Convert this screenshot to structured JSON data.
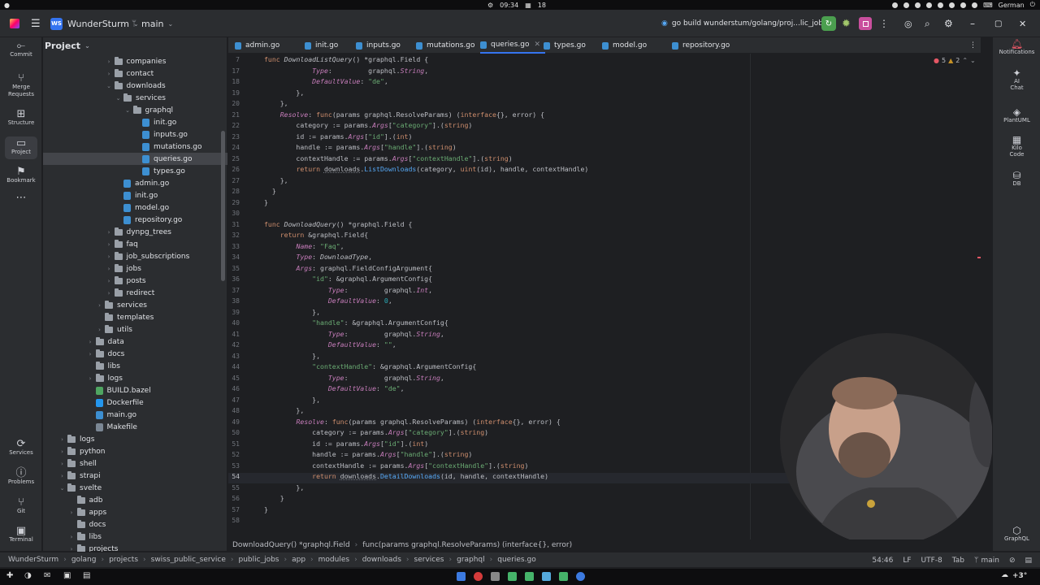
{
  "system_bar": {
    "time": "09:34",
    "calendar_day": "18",
    "lang": "German",
    "weather": "+3°"
  },
  "titlebar": {
    "project_badge": "WS",
    "project_name": "WunderSturm",
    "branch": "main",
    "run_config": "go build wunderstum/golang/proj...lic_jobs"
  },
  "left_strip": {
    "items": [
      {
        "label": "Commit",
        "icon": "commit-icon"
      },
      {
        "label": "Merge Requests",
        "icon": "merge-requests-icon"
      },
      {
        "label": "Structure",
        "icon": "structure-icon"
      },
      {
        "label": "Project",
        "icon": "folder-icon"
      },
      {
        "label": "Bookmark",
        "icon": "bookmark-icon"
      },
      {
        "label": "Services",
        "icon": "services-icon"
      },
      {
        "label": "Problems",
        "icon": "problems-icon"
      },
      {
        "label": "Git",
        "icon": "git-icon"
      },
      {
        "label": "Terminal",
        "icon": "terminal-icon"
      }
    ]
  },
  "project_panel": {
    "title": "Project",
    "tree": [
      {
        "label": "companies",
        "kind": "folder",
        "depth": 7,
        "expanded": false
      },
      {
        "label": "contact",
        "kind": "folder",
        "depth": 7,
        "expanded": false
      },
      {
        "label": "downloads",
        "kind": "folder",
        "depth": 7,
        "expanded": true
      },
      {
        "label": "services",
        "kind": "folder",
        "depth": 8,
        "expanded": true
      },
      {
        "label": "graphql",
        "kind": "folder",
        "depth": 9,
        "expanded": true
      },
      {
        "label": "init.go",
        "kind": "go",
        "depth": 10
      },
      {
        "label": "inputs.go",
        "kind": "go",
        "depth": 10
      },
      {
        "label": "mutations.go",
        "kind": "go",
        "depth": 10
      },
      {
        "label": "queries.go",
        "kind": "go",
        "depth": 10,
        "selected": true
      },
      {
        "label": "types.go",
        "kind": "go",
        "depth": 10
      },
      {
        "label": "admin.go",
        "kind": "go",
        "depth": 8
      },
      {
        "label": "init.go",
        "kind": "go",
        "depth": 8
      },
      {
        "label": "model.go",
        "kind": "go",
        "depth": 8
      },
      {
        "label": "repository.go",
        "kind": "go",
        "depth": 8
      },
      {
        "label": "dynpg_trees",
        "kind": "folder",
        "depth": 7,
        "expanded": false
      },
      {
        "label": "faq",
        "kind": "folder",
        "depth": 7,
        "expanded": false
      },
      {
        "label": "job_subscriptions",
        "kind": "folder",
        "depth": 7,
        "expanded": false
      },
      {
        "label": "jobs",
        "kind": "folder",
        "depth": 7,
        "expanded": false
      },
      {
        "label": "posts",
        "kind": "folder",
        "depth": 7,
        "expanded": false
      },
      {
        "label": "redirect",
        "kind": "folder",
        "depth": 7,
        "expanded": false
      },
      {
        "label": "services",
        "kind": "folder",
        "depth": 6,
        "expanded": false
      },
      {
        "label": "templates",
        "kind": "folder",
        "depth": 6,
        "leaf": true
      },
      {
        "label": "utils",
        "kind": "folder",
        "depth": 6,
        "expanded": false
      },
      {
        "label": "data",
        "kind": "folder",
        "depth": 5,
        "expanded": false
      },
      {
        "label": "docs",
        "kind": "folder",
        "depth": 5,
        "expanded": false
      },
      {
        "label": "libs",
        "kind": "folder",
        "depth": 5,
        "leaf": true
      },
      {
        "label": "logs",
        "kind": "folder",
        "depth": 5,
        "expanded": false
      },
      {
        "label": "BUILD.bazel",
        "kind": "bazel",
        "depth": 5
      },
      {
        "label": "Dockerfile",
        "kind": "docker",
        "depth": 5
      },
      {
        "label": "main.go",
        "kind": "go",
        "depth": 5
      },
      {
        "label": "Makefile",
        "kind": "make",
        "depth": 5
      },
      {
        "label": "logs",
        "kind": "folder",
        "depth": 2,
        "expanded": false
      },
      {
        "label": "python",
        "kind": "folder",
        "depth": 2,
        "expanded": false
      },
      {
        "label": "shell",
        "kind": "folder",
        "depth": 2,
        "expanded": false
      },
      {
        "label": "strapi",
        "kind": "folder",
        "depth": 2,
        "expanded": false
      },
      {
        "label": "svelte",
        "kind": "folder",
        "depth": 2,
        "expanded": true
      },
      {
        "label": "adb",
        "kind": "folder",
        "depth": 3,
        "leaf": true
      },
      {
        "label": "apps",
        "kind": "folder",
        "depth": 3,
        "expanded": false
      },
      {
        "label": "docs",
        "kind": "folder",
        "depth": 3,
        "leaf": true
      },
      {
        "label": "libs",
        "kind": "folder",
        "depth": 3,
        "expanded": false
      },
      {
        "label": "projects",
        "kind": "folder",
        "depth": 3,
        "expanded": false
      }
    ]
  },
  "tabs": [
    {
      "label": "admin.go"
    },
    {
      "label": "init.go"
    },
    {
      "label": "inputs.go"
    },
    {
      "label": "mutations.go"
    },
    {
      "label": "queries.go",
      "active": true
    },
    {
      "label": "types.go"
    },
    {
      "label": "model.go"
    },
    {
      "label": "repository.go"
    }
  ],
  "inspections": {
    "errors": "5",
    "warnings": "2"
  },
  "editor": {
    "lines": [
      {
        "n": "7",
        "html": "<span class=\"kw\">func</span> <span class=\"fn it\">DownloadListQuery</span>() *graphql.Field {"
      },
      {
        "n": "17",
        "html": "            <span class=\"fl\">Type</span>:         graphql.<span class=\"fl\">String</span>,"
      },
      {
        "n": "18",
        "html": "            <span class=\"fl\">DefaultValue</span>: <span class=\"st\">\"de\"</span>,"
      },
      {
        "n": "19",
        "html": "        },"
      },
      {
        "n": "20",
        "html": "    },"
      },
      {
        "n": "21",
        "html": "    <span class=\"fl\">Resolve</span>: <span class=\"kw\">func</span>(params graphql.ResolveParams) (<span class=\"kw\">interface</span>{}, error) {"
      },
      {
        "n": "22",
        "html": "        category := params.<span class=\"fl\">Args</span>[<span class=\"st\">\"category\"</span>].(<span class=\"kw\">string</span>)"
      },
      {
        "n": "23",
        "html": "        id := params.<span class=\"fl\">Args</span>[<span class=\"st\">\"id\"</span>].(<span class=\"kw\">int</span>)"
      },
      {
        "n": "24",
        "html": "        handle := params.<span class=\"fl\">Args</span>[<span class=\"st\">\"handle\"</span>].(<span class=\"kw\">string</span>)"
      },
      {
        "n": "25",
        "html": "        contextHandle := params.<span class=\"fl\">Args</span>[<span class=\"st\">\"contextHandle\"</span>].(<span class=\"kw\">string</span>)"
      },
      {
        "n": "26",
        "html": "        <span class=\"kw\">return</span> <span class=\"pk\">downloads</span>.<span class=\"fn\">ListDownloads</span>(category, <span class=\"kw\">uint</span>(id), handle, contextHandle)"
      },
      {
        "n": "27",
        "html": "    },"
      },
      {
        "n": "28",
        "html": "  }"
      },
      {
        "n": "29",
        "html": "}"
      },
      {
        "n": "30",
        "html": ""
      },
      {
        "n": "31",
        "html": "<span class=\"kw\">func</span> <span class=\"fn it\">DownloadQuery</span>() *graphql.Field {"
      },
      {
        "n": "32",
        "html": "    <span class=\"kw\">return</span> &amp;graphql.Field{"
      },
      {
        "n": "33",
        "html": "        <span class=\"fl\">Name</span>: <span class=\"st\">\"Faq\"</span>,"
      },
      {
        "n": "34",
        "html": "        <span class=\"fl\">Type</span>: <span class=\"it\">DownloadType</span>,"
      },
      {
        "n": "35",
        "html": "        <span class=\"fl\">Args</span>: graphql.FieldConfigArgument{"
      },
      {
        "n": "36",
        "html": "            <span class=\"st\">\"id\"</span>: &amp;graphql.ArgumentConfig{"
      },
      {
        "n": "37",
        "html": "                <span class=\"fl\">Type</span>:         graphql.<span class=\"fl\">Int</span>,"
      },
      {
        "n": "38",
        "html": "                <span class=\"fl\">DefaultValue</span>: <span class=\"nu\">0</span>,"
      },
      {
        "n": "39",
        "html": "            },"
      },
      {
        "n": "40",
        "html": "            <span class=\"st\">\"handle\"</span>: &amp;graphql.ArgumentConfig{"
      },
      {
        "n": "41",
        "html": "                <span class=\"fl\">Type</span>:         graphql.<span class=\"fl\">String</span>,"
      },
      {
        "n": "42",
        "html": "                <span class=\"fl\">DefaultValue</span>: <span class=\"st\">\"\"</span>,"
      },
      {
        "n": "43",
        "html": "            },"
      },
      {
        "n": "44",
        "html": "            <span class=\"st\">\"contextHandle\"</span>: &amp;graphql.ArgumentConfig{"
      },
      {
        "n": "45",
        "html": "                <span class=\"fl\">Type</span>:         graphql.<span class=\"fl\">String</span>,"
      },
      {
        "n": "46",
        "html": "                <span class=\"fl\">DefaultValue</span>: <span class=\"st\">\"de\"</span>,"
      },
      {
        "n": "47",
        "html": "            },"
      },
      {
        "n": "48",
        "html": "        },"
      },
      {
        "n": "49",
        "html": "        <span class=\"fl\">Resolve</span>: <span class=\"kw\">func</span>(params graphql.ResolveParams) (<span class=\"kw\">interface</span>{}, error) {"
      },
      {
        "n": "50",
        "html": "            category := params.<span class=\"fl\">Args</span>[<span class=\"st\">\"category\"</span>].(<span class=\"kw\">string</span>)"
      },
      {
        "n": "51",
        "html": "            id := params.<span class=\"fl\">Args</span>[<span class=\"st\">\"id\"</span>].(<span class=\"kw\">int</span>)"
      },
      {
        "n": "52",
        "html": "            handle := params.<span class=\"fl\">Args</span>[<span class=\"st\">\"handle\"</span>].(<span class=\"kw\">string</span>)"
      },
      {
        "n": "53",
        "html": "            contextHandle := params.<span class=\"fl\">Args</span>[<span class=\"st\">\"contextHandle\"</span>].(<span class=\"kw\">string</span>)"
      },
      {
        "n": "54",
        "html": "            <span class=\"kw\">return</span> <span class=\"pk\">downloads</span>.<span class=\"fn\">DetailDownloads</span>(id, handle, contextHandle)",
        "current": true
      },
      {
        "n": "55",
        "html": "        },"
      },
      {
        "n": "56",
        "html": "    }"
      },
      {
        "n": "57",
        "html": "}"
      },
      {
        "n": "58",
        "html": ""
      }
    ]
  },
  "right_strip": {
    "items": [
      {
        "label": "Notifications",
        "icon": "bell-icon"
      },
      {
        "label": "AI Chat",
        "icon": "ai-chat-icon"
      },
      {
        "label": "PlantUML",
        "icon": "plantuml-icon"
      },
      {
        "label": "Kilo Code",
        "icon": "kilo-code-icon"
      },
      {
        "label": "DB",
        "icon": "database-icon"
      },
      {
        "label": "GraphQL",
        "icon": "graphql-icon"
      }
    ]
  },
  "breadcrumb_code": {
    "left": "DownloadQuery() *graphql.Field",
    "right": "func(params graphql.ResolveParams) (interface{}, error)"
  },
  "status_bar": {
    "path": [
      "WunderSturm",
      "golang",
      "projects",
      "swiss_public_service",
      "public_jobs",
      "app",
      "modules",
      "downloads",
      "services",
      "graphql",
      "queries.go"
    ],
    "position": "54:46",
    "line_ending": "LF",
    "encoding": "UTF-8",
    "indent": "Tab",
    "branch": "main"
  }
}
